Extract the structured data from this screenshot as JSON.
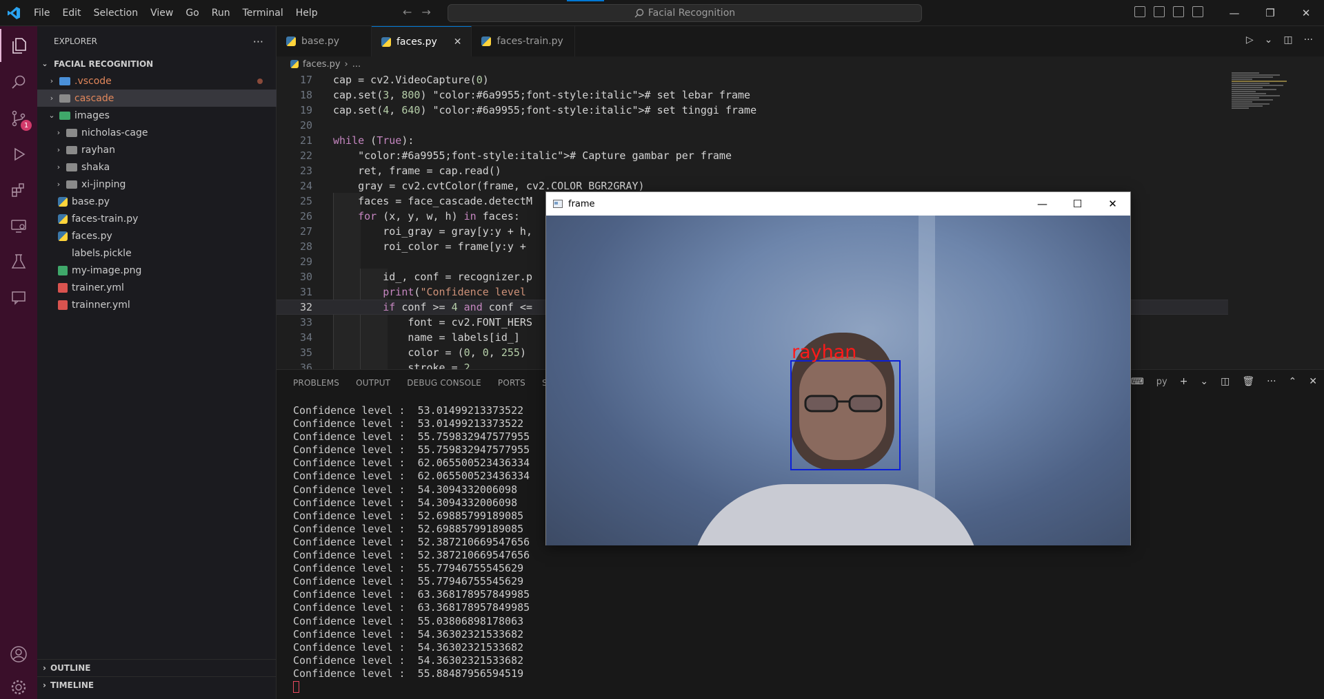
{
  "titlebar": {
    "menu": [
      "File",
      "Edit",
      "Selection",
      "View",
      "Go",
      "Run",
      "Terminal",
      "Help"
    ],
    "search_text": "Facial Recognition",
    "controls": {
      "minimize": "—",
      "restore": "❐",
      "close": "✕"
    }
  },
  "activity_bar": {
    "items": [
      "explorer-icon",
      "search-icon",
      "source-control-icon",
      "run-debug-icon",
      "extensions-icon",
      "remote-explorer-icon",
      "testing-icon",
      "chat-icon"
    ],
    "source_control_badge": "1",
    "bottom": [
      "account-icon",
      "settings-icon"
    ]
  },
  "sidebar": {
    "title": "EXPLORER",
    "more": "···",
    "root": "FACIAL RECOGNITION",
    "tree": [
      {
        "label": ".vscode",
        "kind": "folder",
        "depth": 0,
        "modified": true
      },
      {
        "label": "cascade",
        "kind": "folder",
        "depth": 0,
        "selected": true
      },
      {
        "label": "images",
        "kind": "folder-open",
        "depth": 0
      },
      {
        "label": "nicholas-cage",
        "kind": "folder",
        "depth": 1
      },
      {
        "label": "rayhan",
        "kind": "folder",
        "depth": 1
      },
      {
        "label": "shaka",
        "kind": "folder",
        "depth": 1
      },
      {
        "label": "xi-jinping",
        "kind": "folder",
        "depth": 1
      },
      {
        "label": "base.py",
        "kind": "python",
        "depth": 0
      },
      {
        "label": "faces-train.py",
        "kind": "python",
        "depth": 0
      },
      {
        "label": "faces.py",
        "kind": "python",
        "depth": 0
      },
      {
        "label": "labels.pickle",
        "kind": "file",
        "depth": 0
      },
      {
        "label": "my-image.png",
        "kind": "image",
        "depth": 0
      },
      {
        "label": "trainer.yml",
        "kind": "yaml",
        "depth": 0
      },
      {
        "label": "trainner.yml",
        "kind": "yaml",
        "depth": 0
      }
    ],
    "outline": "OUTLINE",
    "timeline": "TIMELINE"
  },
  "tabs": [
    {
      "label": "base.py",
      "active": false
    },
    {
      "label": "faces.py",
      "active": true
    },
    {
      "label": "faces-train.py",
      "active": false
    }
  ],
  "breadcrumb": {
    "file": "faces.py",
    "rest": "..."
  },
  "code": [
    {
      "n": "17",
      "text": "cap = cv2.VideoCapture(0)"
    },
    {
      "n": "18",
      "text": "cap.set(3, 800) # set lebar frame"
    },
    {
      "n": "19",
      "text": "cap.set(4, 640) # set tinggi frame"
    },
    {
      "n": "20",
      "text": ""
    },
    {
      "n": "21",
      "text": "while (True):"
    },
    {
      "n": "22",
      "text": "    # Capture gambar per frame"
    },
    {
      "n": "23",
      "text": "    ret, frame = cap.read()"
    },
    {
      "n": "24",
      "text": "    gray = cv2.cvtColor(frame, cv2.COLOR_BGR2GRAY)"
    },
    {
      "n": "25",
      "text": "    faces = face_cascade.detectM"
    },
    {
      "n": "26",
      "text": "    for (x, y, w, h) in faces:"
    },
    {
      "n": "27",
      "text": "        roi_gray = gray[y:y + h,"
    },
    {
      "n": "28",
      "text": "        roi_color = frame[y:y +"
    },
    {
      "n": "29",
      "text": ""
    },
    {
      "n": "30",
      "text": "        id_, conf = recognizer.p"
    },
    {
      "n": "31",
      "text": "        print(\"Confidence level"
    },
    {
      "n": "32",
      "text": "        if conf >= 4 and conf <="
    },
    {
      "n": "33",
      "text": "            font = cv2.FONT_HERS"
    },
    {
      "n": "34",
      "text": "            name = labels[id_]"
    },
    {
      "n": "35",
      "text": "            color = (0, 0, 255)"
    },
    {
      "n": "36",
      "text": "            stroke = 2"
    }
  ],
  "current_line": "32",
  "panel": {
    "tabs": [
      "PROBLEMS",
      "OUTPUT",
      "DEBUG CONSOLE",
      "PORTS",
      "SE"
    ],
    "terminal_label": "py",
    "terminal_lines": [
      "Confidence level :  53.01499213373522",
      "Confidence level :  53.01499213373522",
      "Confidence level :  55.759832947577955",
      "Confidence level :  55.759832947577955",
      "Confidence level :  62.065500523436334",
      "Confidence level :  62.065500523436334",
      "Confidence level :  54.3094332006098",
      "Confidence level :  54.3094332006098",
      "Confidence level :  52.69885799189085",
      "Confidence level :  52.69885799189085",
      "Confidence level :  52.387210669547656",
      "Confidence level :  52.387210669547656",
      "Confidence level :  55.77946755545629",
      "Confidence level :  55.77946755545629",
      "Confidence level :  63.368178957849985",
      "Confidence level :  63.368178957849985",
      "Confidence level :  55.03806898178063",
      "Confidence level :  54.36302321533682",
      "Confidence level :  54.36302321533682",
      "Confidence level :  54.36302321533682",
      "Confidence level :  55.88487956594519"
    ]
  },
  "cv_window": {
    "title": "frame",
    "label": "rayhan",
    "label_color": "#ff1a1a",
    "box_color": "#0b1fd6"
  },
  "colors": {
    "activity_bar": "#3a0f2a",
    "accent": "#0078d4"
  }
}
